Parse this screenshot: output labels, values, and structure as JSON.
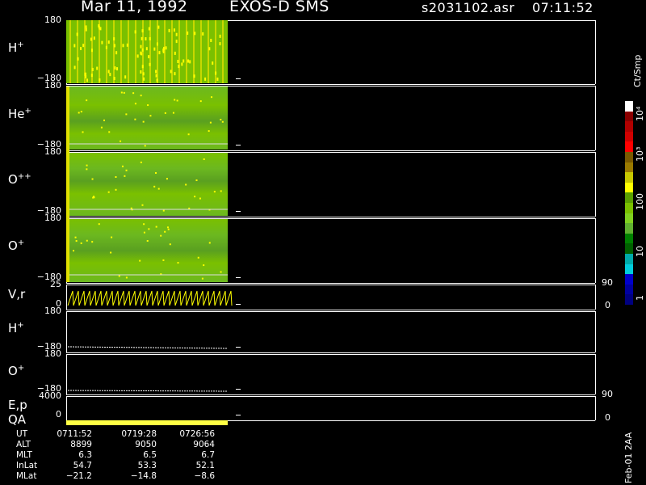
{
  "header": {
    "date": "Mar 11, 1992",
    "instrument": "EXOS-D SMS",
    "filename": "s2031102.asr",
    "time": "07:11:52"
  },
  "panels": [
    {
      "label": "H",
      "sup": "+",
      "ytop": "180",
      "ybot": "−180"
    },
    {
      "label": "He",
      "sup": "+",
      "ytop": "180",
      "ybot": "−180"
    },
    {
      "label": "O",
      "sup": "++",
      "ytop": "180",
      "ybot": "−180"
    },
    {
      "label": "O",
      "sup": "+",
      "ytop": "180",
      "ybot": "−180"
    },
    {
      "label": "V,r",
      "sup": "",
      "ytop": "25",
      "ybot": "0"
    },
    {
      "label": "H",
      "sup": "+",
      "ytop": "180",
      "ybot": "−180"
    },
    {
      "label": "O",
      "sup": "+",
      "ytop": "180",
      "ybot": "−180"
    },
    {
      "label": "E,p",
      "sup": "",
      "ytop": "4000",
      "ybot": "0"
    }
  ],
  "qa_label": "QA",
  "right_ticks": {
    "vr_top": "90",
    "vr_bot": "0",
    "ep_top": "90",
    "ep_bot": "0"
  },
  "colorbar": {
    "title": "Ct/Smp",
    "labels": [
      "10⁴",
      "10³",
      "100",
      "10",
      "1"
    ],
    "colors": [
      "#ffffff",
      "#8b0000",
      "#b00000",
      "#d00000",
      "#ff0000",
      "#7a5a00",
      "#9a7a00",
      "#c8c800",
      "#ffff00",
      "#5aa000",
      "#7ac000",
      "#80d020",
      "#60b030",
      "#008000",
      "#006000",
      "#00aaaa",
      "#00ccdd",
      "#0000cc",
      "#0000a0",
      "#000080"
    ]
  },
  "ephemeris": {
    "labels": [
      "UT",
      "ALT",
      "MLT",
      "InLat",
      "MLat"
    ],
    "columns": [
      [
        "0711:52",
        "8899",
        "6.3",
        "54.7",
        "−21.2"
      ],
      [
        "0719:28",
        "9050",
        "6.5",
        "53.3",
        "−14.8"
      ],
      [
        "0726:56",
        "9064",
        "6.7",
        "52.1",
        "−8.6"
      ]
    ]
  },
  "version": "Feb-01 2AA"
}
